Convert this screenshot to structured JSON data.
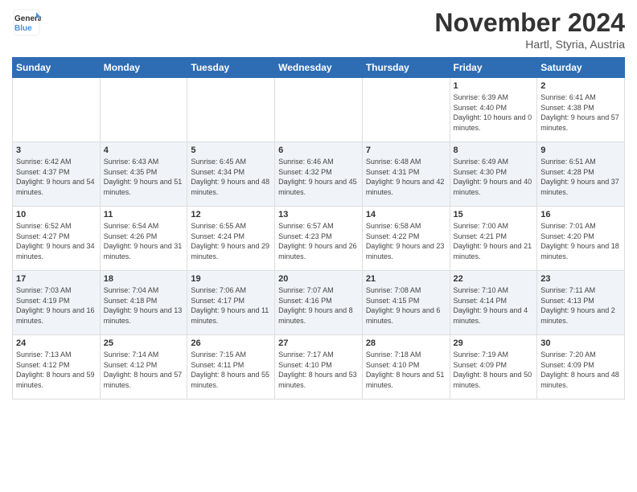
{
  "logo": {
    "line1": "General",
    "line2": "Blue"
  },
  "title": "November 2024",
  "subtitle": "Hartl, Styria, Austria",
  "headers": [
    "Sunday",
    "Monday",
    "Tuesday",
    "Wednesday",
    "Thursday",
    "Friday",
    "Saturday"
  ],
  "rows": [
    [
      {
        "day": "",
        "info": ""
      },
      {
        "day": "",
        "info": ""
      },
      {
        "day": "",
        "info": ""
      },
      {
        "day": "",
        "info": ""
      },
      {
        "day": "",
        "info": ""
      },
      {
        "day": "1",
        "info": "Sunrise: 6:39 AM\nSunset: 4:40 PM\nDaylight: 10 hours and 0 minutes."
      },
      {
        "day": "2",
        "info": "Sunrise: 6:41 AM\nSunset: 4:38 PM\nDaylight: 9 hours and 57 minutes."
      }
    ],
    [
      {
        "day": "3",
        "info": "Sunrise: 6:42 AM\nSunset: 4:37 PM\nDaylight: 9 hours and 54 minutes."
      },
      {
        "day": "4",
        "info": "Sunrise: 6:43 AM\nSunset: 4:35 PM\nDaylight: 9 hours and 51 minutes."
      },
      {
        "day": "5",
        "info": "Sunrise: 6:45 AM\nSunset: 4:34 PM\nDaylight: 9 hours and 48 minutes."
      },
      {
        "day": "6",
        "info": "Sunrise: 6:46 AM\nSunset: 4:32 PM\nDaylight: 9 hours and 45 minutes."
      },
      {
        "day": "7",
        "info": "Sunrise: 6:48 AM\nSunset: 4:31 PM\nDaylight: 9 hours and 42 minutes."
      },
      {
        "day": "8",
        "info": "Sunrise: 6:49 AM\nSunset: 4:30 PM\nDaylight: 9 hours and 40 minutes."
      },
      {
        "day": "9",
        "info": "Sunrise: 6:51 AM\nSunset: 4:28 PM\nDaylight: 9 hours and 37 minutes."
      }
    ],
    [
      {
        "day": "10",
        "info": "Sunrise: 6:52 AM\nSunset: 4:27 PM\nDaylight: 9 hours and 34 minutes."
      },
      {
        "day": "11",
        "info": "Sunrise: 6:54 AM\nSunset: 4:26 PM\nDaylight: 9 hours and 31 minutes."
      },
      {
        "day": "12",
        "info": "Sunrise: 6:55 AM\nSunset: 4:24 PM\nDaylight: 9 hours and 29 minutes."
      },
      {
        "day": "13",
        "info": "Sunrise: 6:57 AM\nSunset: 4:23 PM\nDaylight: 9 hours and 26 minutes."
      },
      {
        "day": "14",
        "info": "Sunrise: 6:58 AM\nSunset: 4:22 PM\nDaylight: 9 hours and 23 minutes."
      },
      {
        "day": "15",
        "info": "Sunrise: 7:00 AM\nSunset: 4:21 PM\nDaylight: 9 hours and 21 minutes."
      },
      {
        "day": "16",
        "info": "Sunrise: 7:01 AM\nSunset: 4:20 PM\nDaylight: 9 hours and 18 minutes."
      }
    ],
    [
      {
        "day": "17",
        "info": "Sunrise: 7:03 AM\nSunset: 4:19 PM\nDaylight: 9 hours and 16 minutes."
      },
      {
        "day": "18",
        "info": "Sunrise: 7:04 AM\nSunset: 4:18 PM\nDaylight: 9 hours and 13 minutes."
      },
      {
        "day": "19",
        "info": "Sunrise: 7:06 AM\nSunset: 4:17 PM\nDaylight: 9 hours and 11 minutes."
      },
      {
        "day": "20",
        "info": "Sunrise: 7:07 AM\nSunset: 4:16 PM\nDaylight: 9 hours and 8 minutes."
      },
      {
        "day": "21",
        "info": "Sunrise: 7:08 AM\nSunset: 4:15 PM\nDaylight: 9 hours and 6 minutes."
      },
      {
        "day": "22",
        "info": "Sunrise: 7:10 AM\nSunset: 4:14 PM\nDaylight: 9 hours and 4 minutes."
      },
      {
        "day": "23",
        "info": "Sunrise: 7:11 AM\nSunset: 4:13 PM\nDaylight: 9 hours and 2 minutes."
      }
    ],
    [
      {
        "day": "24",
        "info": "Sunrise: 7:13 AM\nSunset: 4:12 PM\nDaylight: 8 hours and 59 minutes."
      },
      {
        "day": "25",
        "info": "Sunrise: 7:14 AM\nSunset: 4:12 PM\nDaylight: 8 hours and 57 minutes."
      },
      {
        "day": "26",
        "info": "Sunrise: 7:15 AM\nSunset: 4:11 PM\nDaylight: 8 hours and 55 minutes."
      },
      {
        "day": "27",
        "info": "Sunrise: 7:17 AM\nSunset: 4:10 PM\nDaylight: 8 hours and 53 minutes."
      },
      {
        "day": "28",
        "info": "Sunrise: 7:18 AM\nSunset: 4:10 PM\nDaylight: 8 hours and 51 minutes."
      },
      {
        "day": "29",
        "info": "Sunrise: 7:19 AM\nSunset: 4:09 PM\nDaylight: 8 hours and 50 minutes."
      },
      {
        "day": "30",
        "info": "Sunrise: 7:20 AM\nSunset: 4:09 PM\nDaylight: 8 hours and 48 minutes."
      }
    ]
  ]
}
